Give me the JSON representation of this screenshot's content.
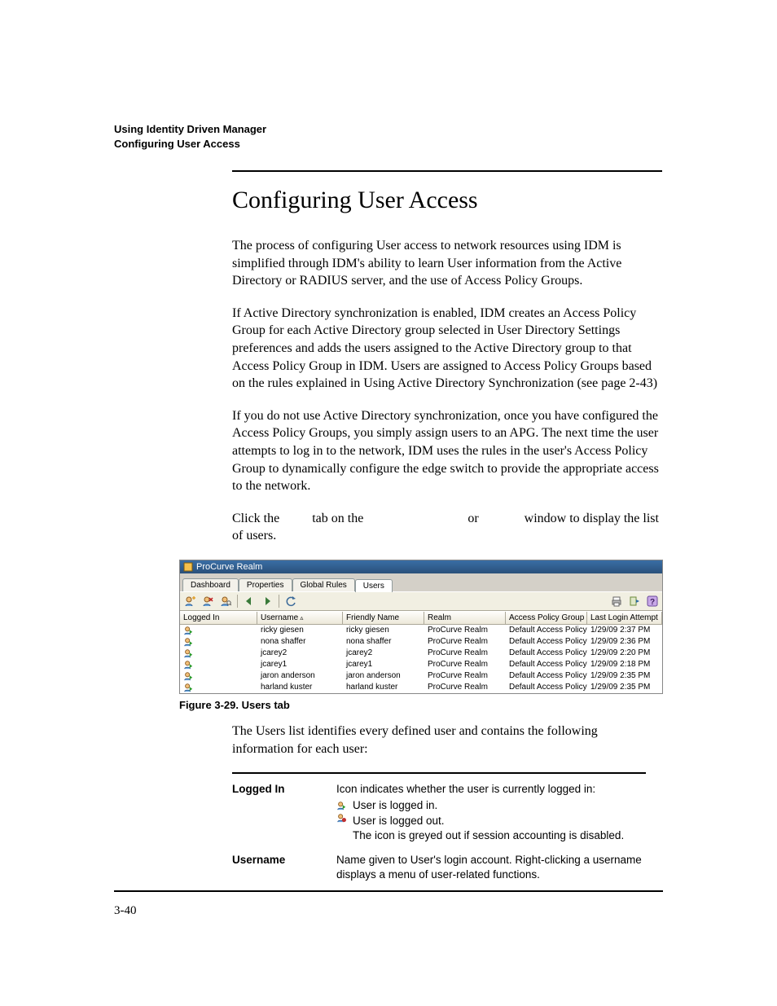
{
  "header": {
    "line1": "Using Identity Driven Manager",
    "line2": "Configuring User Access"
  },
  "section_heading": "Configuring User Access",
  "paragraphs": {
    "p1": "The process of configuring User access to network resources using IDM is simplified through IDM's ability to learn User information from the Active Directory or RADIUS server, and the use of Access Policy Groups.",
    "p2": "If Active Directory synchronization is enabled, IDM creates an Access Policy Group for each Active Directory group selected in User Directory Settings preferences and adds the users assigned to the Active Directory group to that Access Policy Group in IDM. Users are assigned to Access Policy Groups based on the rules explained in Using Active Directory Synchronization (see page 2-43)",
    "p3": "If you do not use Active Directory synchronization, once you have configured the Access Policy Groups, you simply assign users to an APG. The next time the user attempts to log in to the network, IDM uses the rules in the user's Access Policy Group to dynamically configure the edge switch to provide the appropriate access to the network.",
    "p4_a": "Click the ",
    "p4_b": " tab on the ",
    "p4_c": " or ",
    "p4_d": " window to display the list of users."
  },
  "screenshot": {
    "window_title": "ProCurve Realm",
    "tabs": [
      "Dashboard",
      "Properties",
      "Global Rules",
      "Users"
    ],
    "active_tab_index": 3,
    "columns": [
      "Logged In",
      "Username",
      "Friendly Name",
      "Realm",
      "Access Policy Group",
      "Last Login Attempt"
    ],
    "sorted_col_index": 1,
    "rows": [
      {
        "logged_in": true,
        "username": "ricky giesen",
        "friendly": "ricky giesen",
        "realm": "ProCurve Realm",
        "apg": "Default Access Policy Gro...",
        "last": "1/29/09 2:37 PM"
      },
      {
        "logged_in": true,
        "username": "nona shaffer",
        "friendly": "nona shaffer",
        "realm": "ProCurve Realm",
        "apg": "Default Access Policy Gro...",
        "last": "1/29/09 2:36 PM"
      },
      {
        "logged_in": true,
        "username": "jcarey2",
        "friendly": "jcarey2",
        "realm": "ProCurve Realm",
        "apg": "Default Access Policy Gro...",
        "last": "1/29/09 2:20 PM"
      },
      {
        "logged_in": true,
        "username": "jcarey1",
        "friendly": "jcarey1",
        "realm": "ProCurve Realm",
        "apg": "Default Access Policy Gro...",
        "last": "1/29/09 2:18 PM"
      },
      {
        "logged_in": true,
        "username": "jaron anderson",
        "friendly": "jaron anderson",
        "realm": "ProCurve Realm",
        "apg": "Default Access Policy Gro...",
        "last": "1/29/09 2:35 PM"
      },
      {
        "logged_in": true,
        "username": "harland kuster",
        "friendly": "harland kuster",
        "realm": "ProCurve Realm",
        "apg": "Default Access Policy Gro...",
        "last": "1/29/09 2:35 PM"
      }
    ]
  },
  "figure_caption": "Figure 3-29. Users tab",
  "post_figure_text": "The Users list identifies every defined user and contains the following information for each user:",
  "desc_table": {
    "row1": {
      "label": "Logged In",
      "line1": "Icon indicates whether the user is currently logged in:",
      "sub1": "User is logged in.",
      "sub2": "User is logged out.",
      "sub3": "The icon is greyed out if session accounting is disabled."
    },
    "row2": {
      "label": "Username",
      "text": "Name given to User's login account. Right-clicking a username displays a menu of user-related functions."
    }
  },
  "page_num": "3-40"
}
